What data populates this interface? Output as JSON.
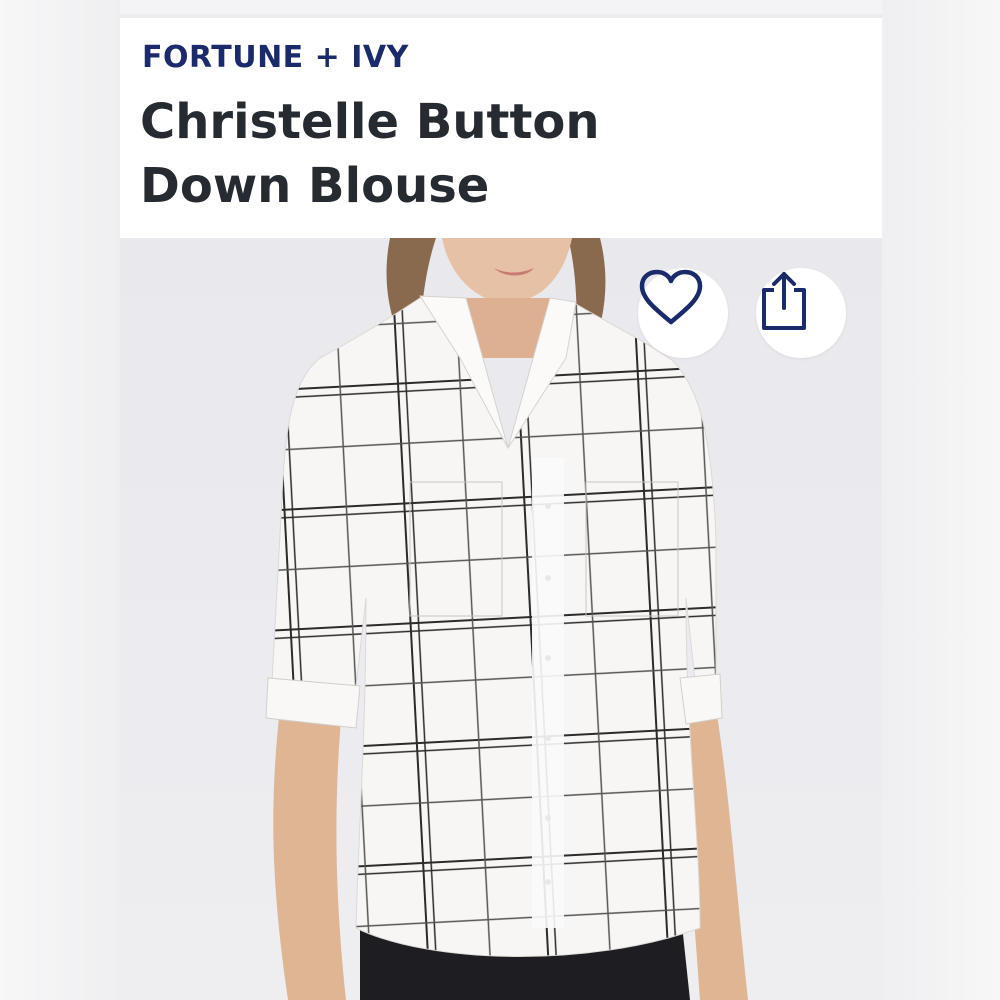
{
  "product": {
    "brand": "FORTUNE + IVY",
    "title": "Christelle Button Down Blouse",
    "image_description_icon": "product-photo",
    "colors": {
      "brand": "#1b2a6b",
      "title": "#262a31",
      "icon": "#1b2a6b"
    }
  },
  "actions": {
    "favorite_icon": "heart-icon",
    "share_icon": "share-icon"
  }
}
